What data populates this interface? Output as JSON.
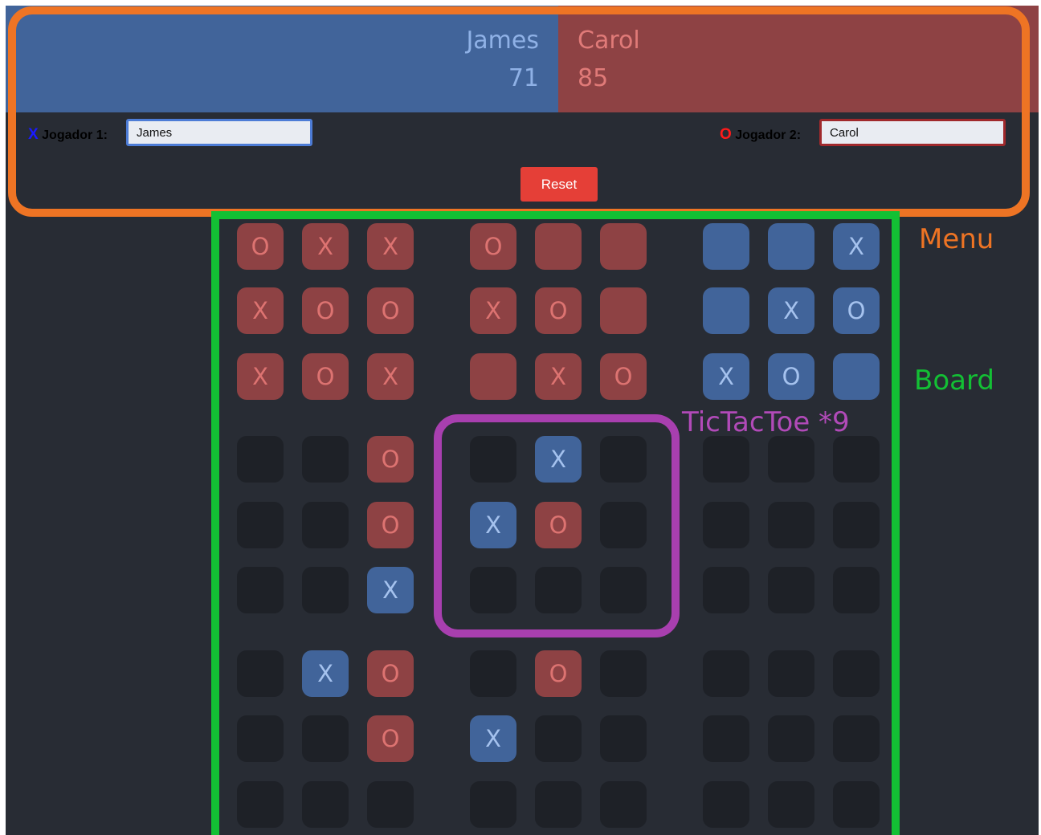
{
  "scoreboard": {
    "player_x": {
      "name": "James",
      "score": "71"
    },
    "player_o": {
      "name": "Carol",
      "score": "85"
    }
  },
  "menu": {
    "p1_mark": "X",
    "p1_label": "Jogador 1:",
    "p1_value": "James",
    "p2_mark": "O",
    "p2_label": "Jogador 2:",
    "p2_value": "Carol",
    "reset_label": "Reset"
  },
  "annotations": {
    "menu": "Menu",
    "board": "Board",
    "tictactoe": "TicTacToe *9"
  },
  "board": {
    "boards": [
      {
        "winner": "O",
        "cells": [
          "O",
          "X",
          "X",
          "X",
          "O",
          "O",
          "X",
          "O",
          "X"
        ]
      },
      {
        "winner": "O",
        "cells": [
          "O",
          "",
          "",
          "X",
          "O",
          "",
          "",
          "X",
          "O"
        ]
      },
      {
        "winner": "X",
        "cells": [
          "",
          "",
          "X",
          "",
          "X",
          "O",
          "X",
          "O",
          ""
        ]
      },
      {
        "winner": "",
        "cells": [
          "",
          "",
          "O",
          "",
          "",
          "O",
          "",
          "",
          "X"
        ]
      },
      {
        "winner": "",
        "cells": [
          "",
          "X",
          "",
          "X",
          "O",
          "",
          "",
          "",
          ""
        ]
      },
      {
        "winner": "",
        "cells": [
          "",
          "",
          "",
          "",
          "",
          "",
          "",
          "",
          ""
        ]
      },
      {
        "winner": "",
        "cells": [
          "",
          "X",
          "O",
          "",
          "",
          "O",
          "",
          "",
          ""
        ]
      },
      {
        "winner": "",
        "cells": [
          "",
          "O",
          "",
          "X",
          "",
          "",
          "",
          "",
          ""
        ]
      },
      {
        "winner": "",
        "cells": [
          "",
          "",
          "",
          "",
          "",
          "",
          "",
          "",
          ""
        ]
      }
    ]
  },
  "colors": {
    "x_color": "#41649a",
    "o_color": "#8e4244",
    "background": "#282c34",
    "empty_cell": "#1e2127",
    "reset_button": "#e53f37"
  }
}
